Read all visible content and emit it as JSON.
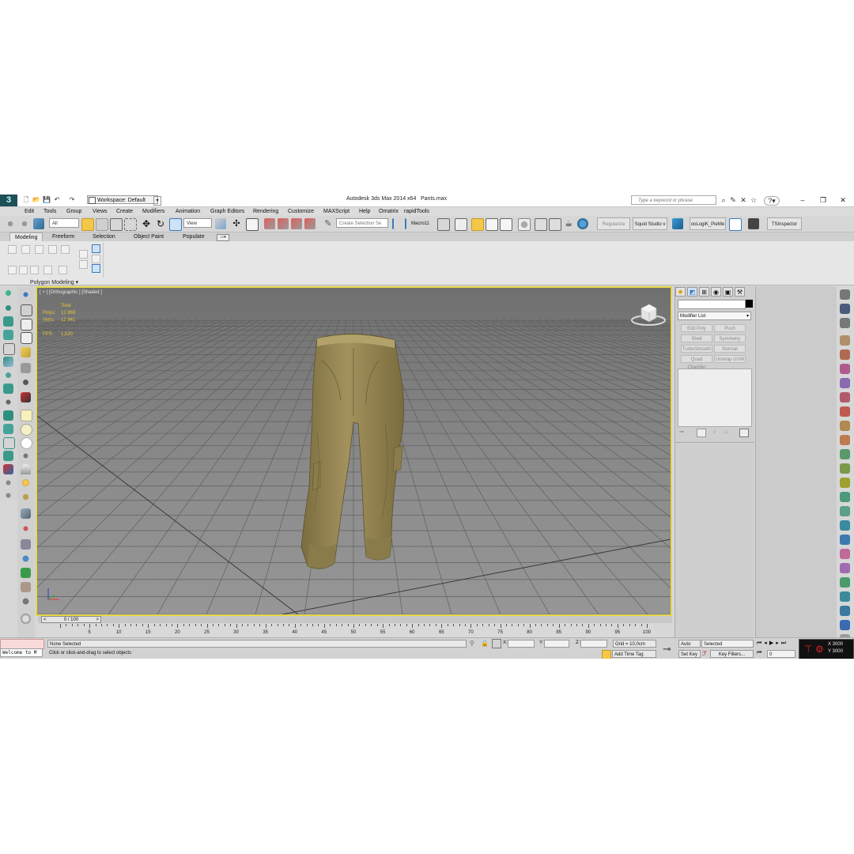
{
  "app": {
    "title": "Autodesk 3ds Max  2014 x64",
    "file": "Pants.max",
    "workspace": "Workspace: Default",
    "search_placeholder": "Type a keyword or phrase"
  },
  "menu": [
    "Edit",
    "Tools",
    "Group",
    "Views",
    "Create",
    "Modifiers",
    "Animation",
    "Graph Editors",
    "Rendering",
    "Customize",
    "MAXScript",
    "Help",
    "Ornatrix",
    "rapidTools"
  ],
  "toolbar": {
    "selection_filter": "All",
    "coord_system": "View",
    "named_selection_placeholder": "Create Selection Se",
    "macro": "Macro11",
    "plugins": [
      "Regularize",
      "Squid Studio v",
      "ooLogiK_PieMe",
      "TSInspector"
    ]
  },
  "ribbon": {
    "tabs": [
      "Modeling",
      "Freeform",
      "Selection",
      "Object Paint",
      "Populate"
    ],
    "panel_label": "Polygon Modeling"
  },
  "viewport": {
    "label": "[ + ] [Orthographic ] [Shaded ]",
    "stats": {
      "total_label": "Total",
      "polys_label": "Polys:",
      "polys": "12 869",
      "verts_label": "Verts:",
      "verts": "12 941",
      "fps_label": "FPS:",
      "fps": "1,520"
    }
  },
  "command_panel": {
    "modifier_list": "Modifier List",
    "buttons": [
      "Edit Poly",
      "Push",
      "Shell",
      "Symmetry",
      "TurboSmooth",
      "Normal",
      "Quad Chamfer",
      "Unwrap UVW"
    ]
  },
  "timeline": {
    "slider": "0 / 100",
    "ticks": [
      5,
      10,
      15,
      20,
      25,
      30,
      35,
      40,
      45,
      50,
      55,
      60,
      65,
      70,
      75,
      80,
      85,
      90,
      95,
      100
    ]
  },
  "status": {
    "maxscript": "Welcome to M",
    "selection": "None Selected",
    "prompt": "Click or click-and-drag to select objects",
    "x_label": "X:",
    "y_label": "Y:",
    "z_label": "Z:",
    "grid": "Grid = 10,0cm",
    "add_time_tag": "Add Time Tag",
    "auto_key": "Auto Key",
    "set_key": "Set Key",
    "selected": "Selected",
    "key_filters": "Key Filters...",
    "frame": "0",
    "nav_x": "X 3000",
    "nav_y": "Y 3000"
  },
  "colors": {
    "viewport_border": "#e4d84a",
    "stats_text": "#e5c437",
    "pants": "#9a8a55"
  }
}
